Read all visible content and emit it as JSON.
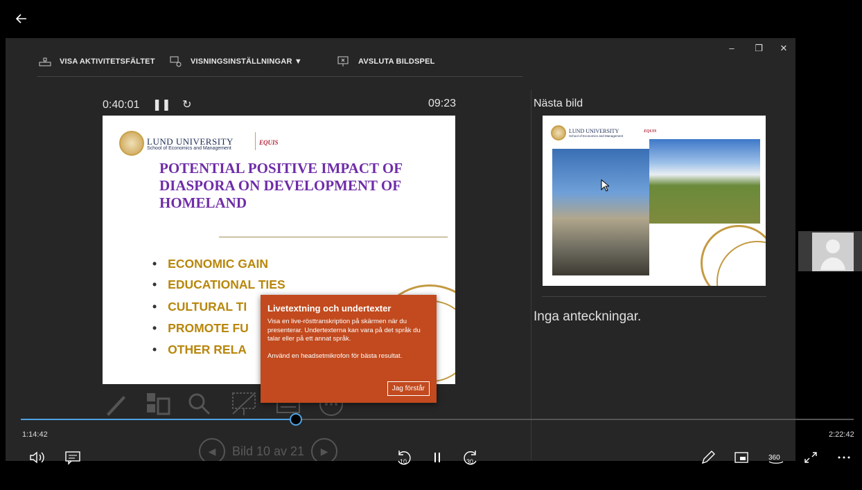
{
  "toolbar": {
    "taskbar_label": "VISA AKTIVITETSFÄLTET",
    "display_settings_label": "VISNINGSINSTÄLLNINGAR ▼",
    "end_show_label": "AVSLUTA BILDSPEL"
  },
  "window": {
    "minimize": "–",
    "restore": "❐",
    "close": "✕"
  },
  "presenter": {
    "timer": "0:40:01",
    "clock": "09:23",
    "next_label": "Nästa bild",
    "notes": "Inga anteckningar."
  },
  "slide": {
    "university": "LUND UNIVERSITY",
    "school": "School of Economics and Management",
    "accreditation": "EQUIS",
    "heading": "POTENTIAL POSITIVE IMPACT OF DIASPORA ON DEVELOPMENT OF HOMELAND",
    "bullets": [
      "ECONOMIC GAIN",
      "EDUCATIONAL TIES",
      "CULTURAL TI",
      "PROMOTE FU",
      "OTHER RELA"
    ]
  },
  "tooltip": {
    "title": "Livetextning och undertexter",
    "body": "Visa en live-rösttranskription på skärmen när du presenterar. Undertexterna kan vara på det språk du talar eller på ett annat språk.",
    "body2": "Använd en headsetmikrofon för bästa resultat.",
    "button": "Jag förstår"
  },
  "slide_nav": {
    "counter": "Bild 10 av 21"
  },
  "player": {
    "elapsed": "1:14:42",
    "total": "2:22:42",
    "progress": 0.33,
    "skip_back": "10",
    "skip_forward": "30",
    "view_360": "360"
  },
  "colors": {
    "accent": "#4fa3e6",
    "tooltip": "#c24a1e",
    "heading": "#6f2da8",
    "bullet": "#b8860b"
  }
}
